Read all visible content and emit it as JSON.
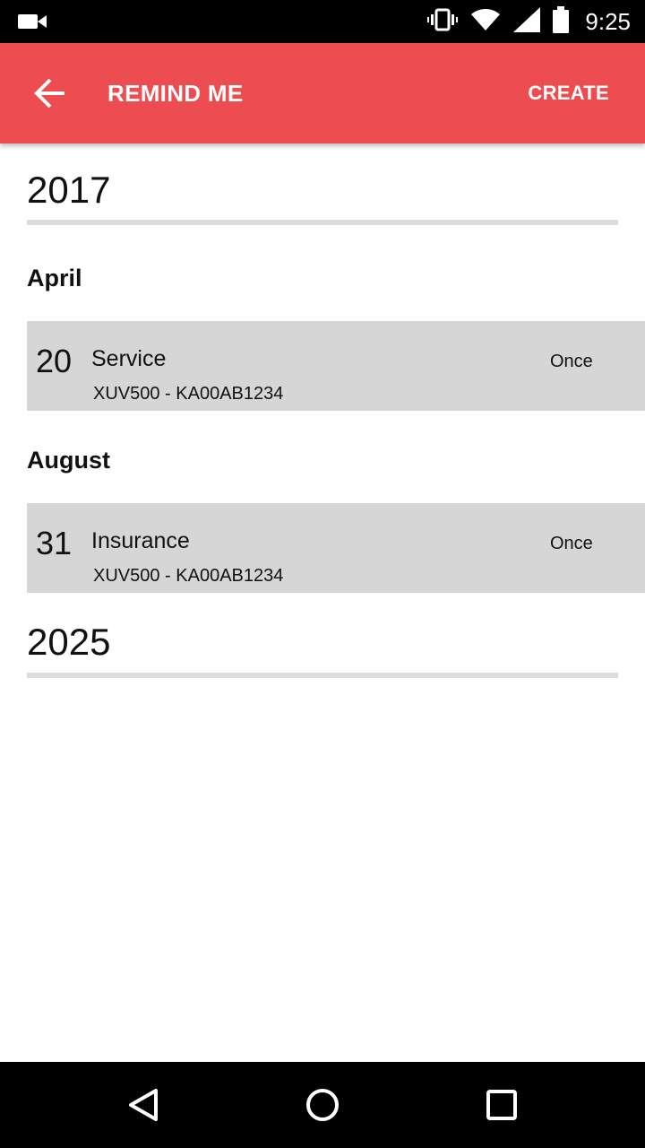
{
  "status_bar": {
    "time": "9:25",
    "icons": [
      "video-camera-icon",
      "vibrate-icon",
      "wifi-icon",
      "signal-icon",
      "battery-icon"
    ]
  },
  "app_bar": {
    "title": "REMIND ME",
    "action_label": "CREATE",
    "color": "#ed4c51",
    "back_icon": "arrow-left-icon"
  },
  "groups": [
    {
      "year": "2017",
      "months": [
        {
          "month": "April",
          "reminders": [
            {
              "day": "20",
              "name": "Service",
              "vehicle": "XUV500 - KA00AB1234",
              "frequency": "Once"
            }
          ]
        },
        {
          "month": "August",
          "reminders": [
            {
              "day": "31",
              "name": "Insurance",
              "vehicle": "XUV500 - KA00AB1234",
              "frequency": "Once"
            }
          ]
        }
      ]
    },
    {
      "year": "2025",
      "months": []
    }
  ],
  "nav_bar": {
    "icons": [
      "back-triangle-icon",
      "home-circle-icon",
      "recents-square-icon"
    ]
  }
}
